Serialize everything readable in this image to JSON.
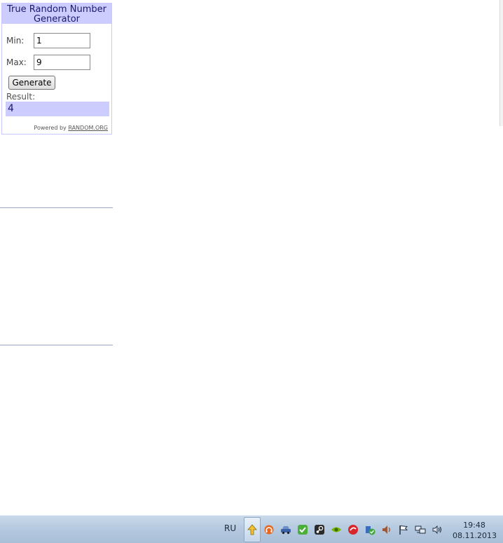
{
  "widget": {
    "title": "True Random Number Generator",
    "min_label": "Min:",
    "min_value": "1",
    "max_label": "Max:",
    "max_value": "9",
    "generate_label": "Generate",
    "result_label": "Result:",
    "result_value": "4",
    "powered_prefix": "Powered by",
    "powered_link": "RANDOM.ORG"
  },
  "taskbar": {
    "language": "RU",
    "tray_icons": [
      "upload-arrow-icon",
      "headset-icon",
      "car-icon",
      "shield-check-icon",
      "steam-icon",
      "nvidia-icon",
      "antivirus-icon",
      "security-check-icon",
      "speaker-icon",
      "flag-icon",
      "network-icon",
      "volume-icon"
    ],
    "time": "19:48",
    "date": "08.11.2013"
  },
  "colors": {
    "widget_header_bg": "#ccccff",
    "result_bg": "#ccccff",
    "taskbar_bg": "#b4c9df"
  }
}
